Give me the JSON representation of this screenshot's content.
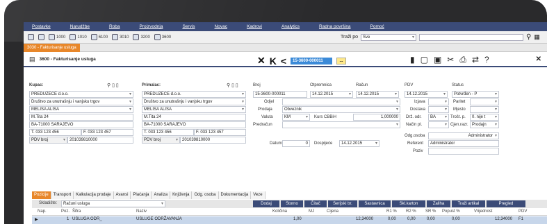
{
  "menu": [
    "Postavke",
    "Narudžbe",
    "Roba",
    "Proizvodnja",
    "Servis",
    "Novac",
    "Kadrovi",
    "Analytics",
    "Radna površina",
    "Pomoć"
  ],
  "toolbar": {
    "items": [
      "1000",
      "1010",
      "6100",
      "3010",
      "3200",
      "3600"
    ],
    "search_label": "Traži po",
    "search_value": "Sve"
  },
  "tab": "3030 - Fakturisanje usluga",
  "doc": {
    "title": "3600 - Fakturisanje usluga",
    "record": "15-3600-000011",
    "record_btn": "..."
  },
  "kupac": {
    "label": "Kupac:",
    "name": "PREDUZEĆE d.o.o.",
    "type": "Društvo za unutrašnju i vanjsku trgov",
    "contact": "MELISA ALIŠA",
    "street": "M.Tita 24",
    "city": "BA-71000 SARAJEVO",
    "phone": "T. 033 123 456",
    "fax": "F. 033 123 457",
    "pdv_label": "PDV broj",
    "pdv": "201039810000"
  },
  "primalac": {
    "label": "Primalac:",
    "name": "PREDUZEĆE d.o.o.",
    "type": "Društvo za unutrašnju i vanjsku trgov",
    "contact": "MELISA ALIŠA",
    "street": "M.Tita 24",
    "city": "BA-71000 SARAJEVO",
    "phone": "T. 033 123 456",
    "fax": "F. 033 123 457",
    "pdv_label": "PDV broj",
    "pdv": "201039810000"
  },
  "header": {
    "broj_label": "Broj",
    "broj": "15-3600-000011",
    "otpremnica_label": "Otpremnica",
    "otpremnica": "14.12.2015",
    "racun_label": "Račun",
    "racun": "14.12.2015",
    "pdv_label": "PDV",
    "pdv": "14.12.2015",
    "status_label": "Status",
    "status": "Potvrđen - P"
  },
  "mid": {
    "odjel_label": "Odjel",
    "prodaja_label": "Prodaja",
    "prodaja": "Obveznik",
    "valuta_label": "Valuta",
    "valuta": "KM",
    "kurs_label": "Kurs CBBiH",
    "kurs": "1,000000",
    "predracun_label": "Predračun",
    "datum_label": "Datum",
    "datum": "0",
    "dospijece_label": "Dospijeće",
    "dospijece": "14.12.2015"
  },
  "right": {
    "izjava": "Izjava",
    "paritet": "Paritet",
    "dostava": "Dostava",
    "mjesto": "Mjesto",
    "drz_odr": "Drž. odr.",
    "drz_val": "BA",
    "trost": "Trošt. p.",
    "trost_val": "0. nije t",
    "nacin": "Način pl.",
    "cjen": "Cjen.razr.",
    "cjen_val": "Prodajn",
    "odg_label": "Odg.osoba",
    "odg": "Administrator",
    "referent_label": "Referent",
    "referent": "Administrator",
    "poziv_label": "Poziv"
  },
  "subtabs": [
    "Pozicije",
    "Transport",
    "Kalkulacija prodaje",
    "Avansi",
    "Plaćanja",
    "Analiza",
    "Knjiženja",
    "Odg. osoba",
    "Dokumentacija",
    "Veze"
  ],
  "gridbar": {
    "skladiste_label": "Skladište:",
    "skladiste": "Računi usluga",
    "buttons": [
      "Dodaj",
      "Storno",
      "Čitač",
      "Serijski br.",
      "Sastavnica",
      "Skl.karton",
      "Zaliha",
      "Traži artikal",
      "Pregled"
    ]
  },
  "columns": [
    "Nap.",
    "Poz.",
    "Šifra",
    "Naziv",
    "Količina",
    "MJ",
    "Cijena",
    "R1 %",
    "R2 %",
    "SR %",
    "Popust %",
    "Vrijednost",
    "PDV"
  ],
  "rows": [
    {
      "poz": "1",
      "sifra": "USLUGA ODR_",
      "naziv": "USLUGE ODRŽAVANJA",
      "kolicina": "1,00",
      "mj": "",
      "cijena": "12,34000",
      "r1": "0,00",
      "r2": "0,00",
      "sr": "0,00",
      "popust": "0,00",
      "vrijednost": "12,34000",
      "pdv": "F1"
    }
  ]
}
